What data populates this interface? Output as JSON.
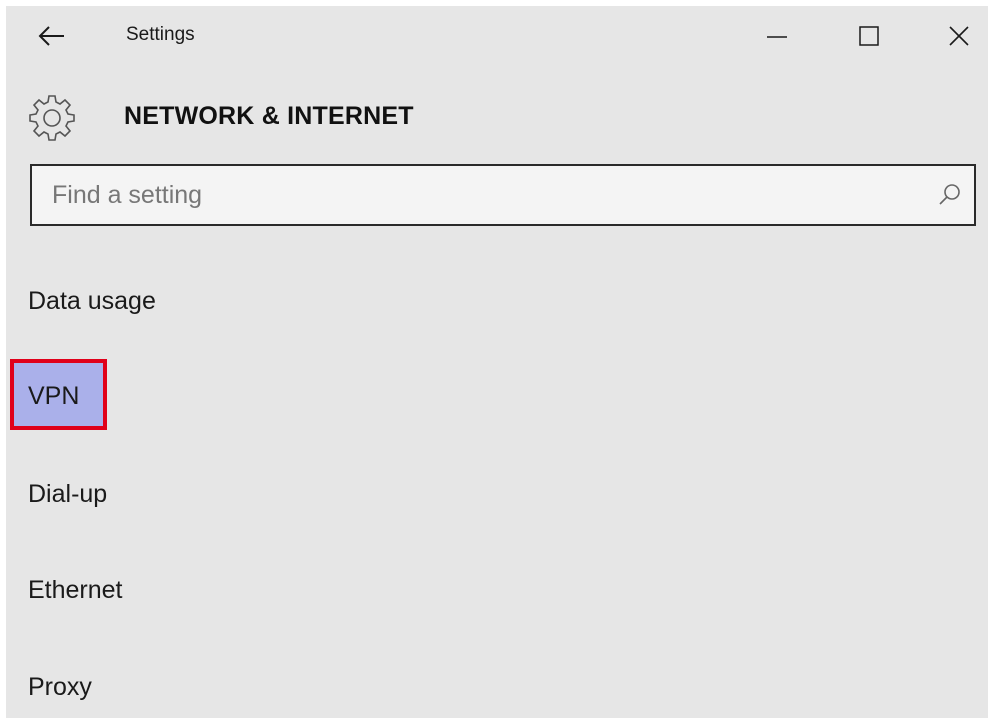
{
  "window": {
    "title": "Settings",
    "controls": {
      "minimize": "minimize-icon",
      "maximize": "maximize-icon",
      "close": "close-icon"
    },
    "back_icon": "back-arrow-icon"
  },
  "header": {
    "icon": "gear-icon",
    "title": "NETWORK & INTERNET"
  },
  "search": {
    "placeholder": "Find a setting",
    "icon": "search-icon"
  },
  "nav": {
    "items": [
      {
        "label": "Data usage"
      },
      {
        "label": "VPN",
        "highlighted": true
      },
      {
        "label": "Dial-up"
      },
      {
        "label": "Ethernet"
      },
      {
        "label": "Proxy"
      }
    ]
  },
  "colors": {
    "background": "#e6e6e6",
    "highlight_fill": "#aab0ea",
    "highlight_border": "#e0001a"
  }
}
